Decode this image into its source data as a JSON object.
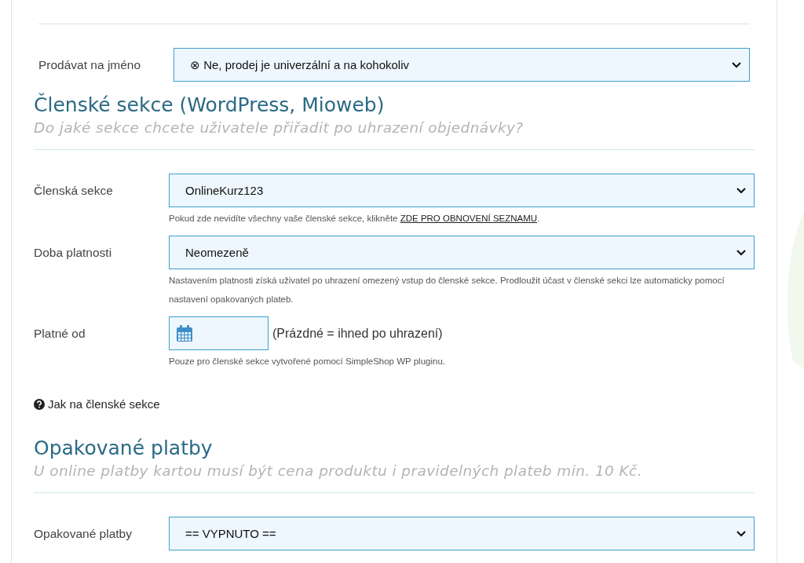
{
  "sections": [
    {
      "fields": [
        {
          "kind": "select",
          "label": "Prodávat na jméno",
          "value": "⊗ Ne, prodej je univerzální a na kohokoliv"
        }
      ]
    },
    {
      "title": "Členské sekce (WordPress, Mioweb)",
      "subtitle": "Do jaké sekce chcete uživatele přiřadit po uhrazení objednávky?",
      "fields": [
        {
          "kind": "select",
          "label": "Členská sekce",
          "value": "OnlineKurz123",
          "help": "Pokud zde nevidíte všechny vaše členské sekce, klikněte ",
          "help_link": "ZDE PRO OBNOVENÍ SEZNAMU",
          "help_after": "."
        },
        {
          "kind": "select",
          "label": "Doba platnosti",
          "value": "Neomezeně",
          "help": "Nastavením platnosti získá uživatel po uhrazení omezený vstup do členské sekce. Prodloužit účast v členské sekci lze automaticky pomocí nastavení opakovaných plateb."
        },
        {
          "kind": "date",
          "label": "Platné od",
          "note": "(Prázdné = ihned po uhrazení)",
          "help": "Pouze pro členské sekce vytvořené pomocí SimpleShop WP pluginu."
        }
      ],
      "help_link": "Jak na členské sekce"
    },
    {
      "title": "Opakované platby",
      "subtitle": "U online platby kartou musí být cena produktu i pravidelných plateb min. 10 Kč.",
      "fields": [
        {
          "kind": "select",
          "label": "Opakované platby",
          "value": "== VYPNUTO =="
        }
      ]
    }
  ]
}
